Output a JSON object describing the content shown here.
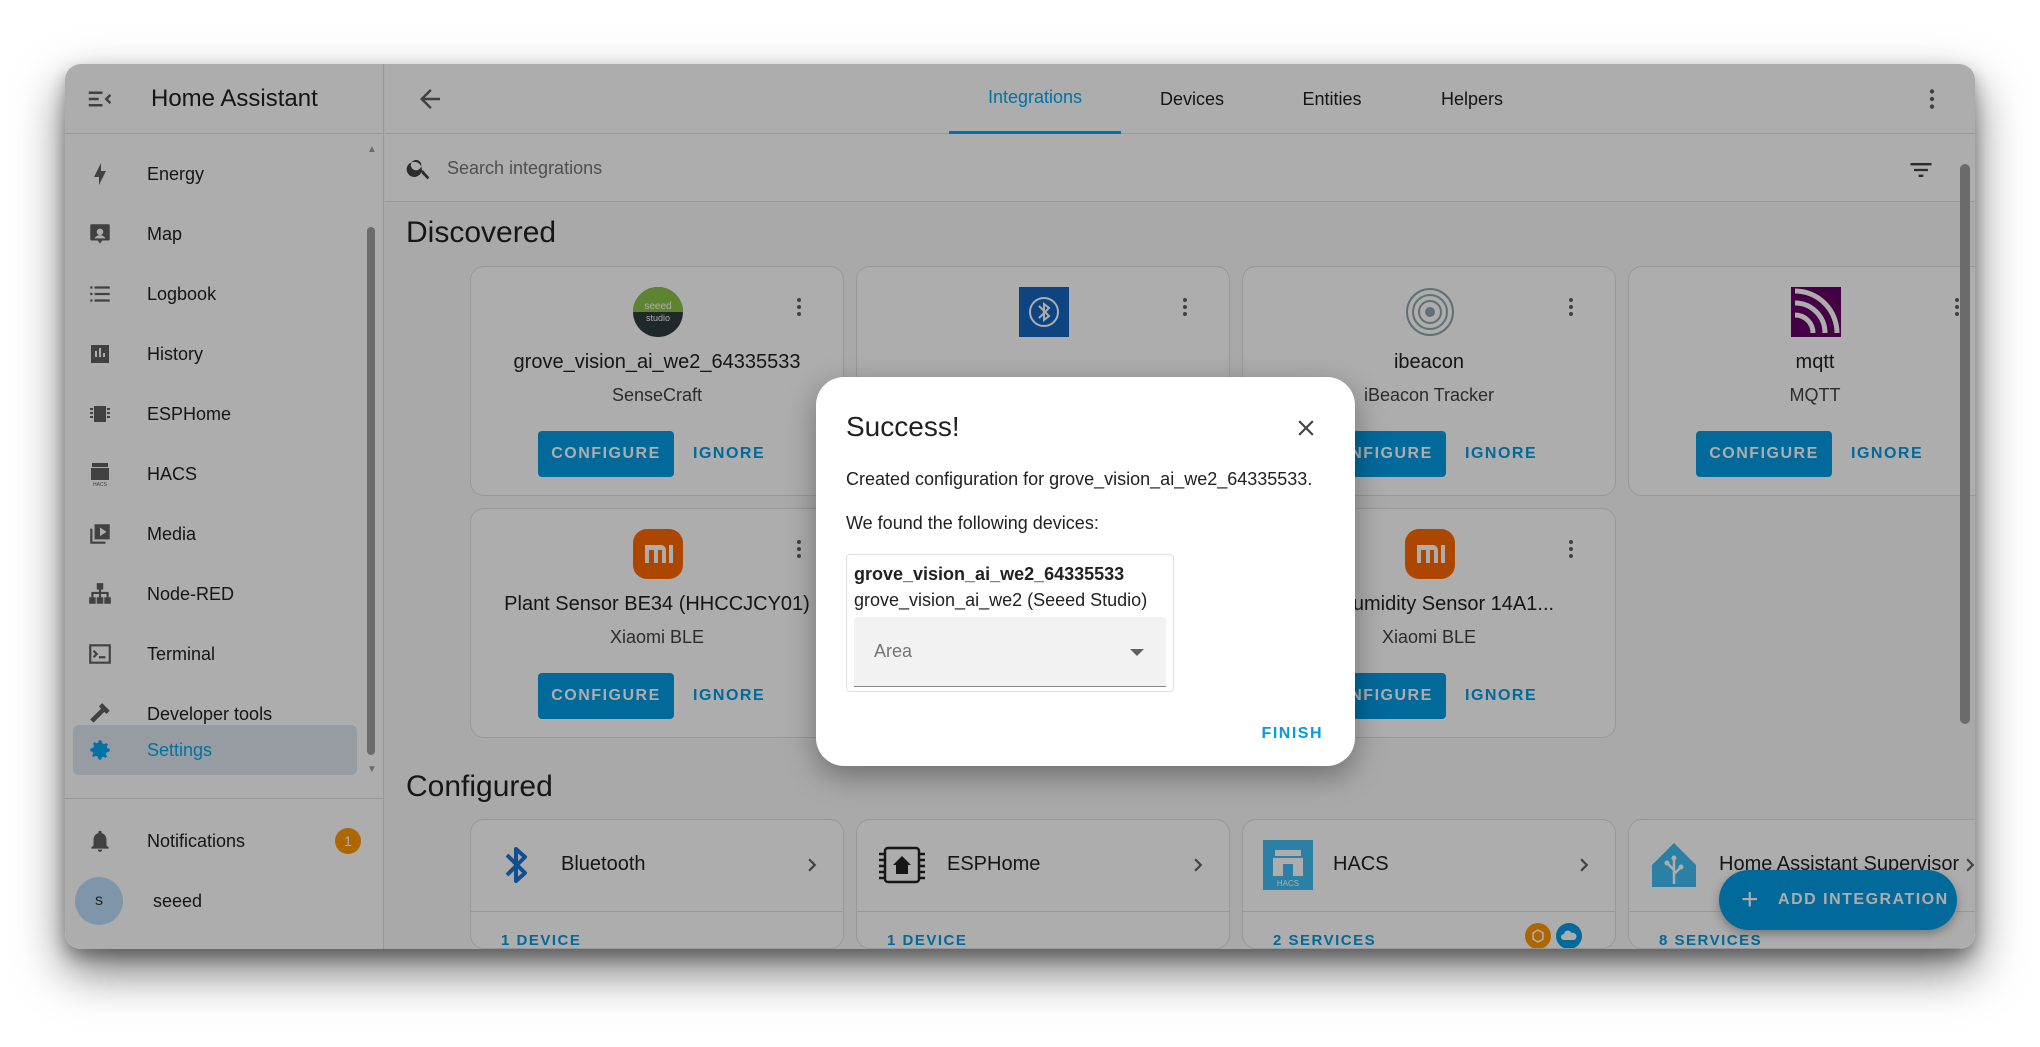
{
  "app": {
    "title": "Home Assistant"
  },
  "sidebar": {
    "items": [
      {
        "label": "Energy",
        "icon": "lightning-icon"
      },
      {
        "label": "Map",
        "icon": "map-icon"
      },
      {
        "label": "Logbook",
        "icon": "logbook-icon"
      },
      {
        "label": "History",
        "icon": "history-icon"
      },
      {
        "label": "ESPHome",
        "icon": "chip-icon"
      },
      {
        "label": "HACS",
        "icon": "hacs-icon"
      },
      {
        "label": "Media",
        "icon": "media-icon"
      },
      {
        "label": "Node-RED",
        "icon": "sitemap-icon"
      },
      {
        "label": "Terminal",
        "icon": "terminal-icon"
      },
      {
        "label": "Developer tools",
        "icon": "hammer-icon"
      },
      {
        "label": "Settings",
        "icon": "gear-icon",
        "active": true
      }
    ],
    "notifications": {
      "label": "Notifications",
      "count": "1"
    },
    "user": {
      "initial": "s",
      "name": "seeed"
    }
  },
  "tabs": [
    "Integrations",
    "Devices",
    "Entities",
    "Helpers"
  ],
  "search": {
    "placeholder": "Search integrations"
  },
  "discovered": {
    "title": "Discovered",
    "cards": [
      {
        "name": "grove_vision_ai_we2_64335533",
        "sub": "SenseCraft",
        "configure": "CONFIGURE",
        "ignore": "IGNORE"
      },
      {
        "name": "",
        "sub": "",
        "configure": "",
        "ignore": ""
      },
      {
        "name": "ibeacon",
        "sub": "iBeacon Tracker",
        "configure": "CONFIGURE",
        "ignore": "IGNORE"
      },
      {
        "name": "mqtt",
        "sub": "MQTT",
        "configure": "CONFIGURE",
        "ignore": "IGNORE"
      },
      {
        "name": "Plant Sensor BE34 (HHCCJCY01)",
        "sub": "Xiaomi BLE",
        "configure": "CONFIGURE",
        "ignore": "IGNORE"
      },
      {
        "name": "",
        "sub": "",
        "configure": "",
        "ignore": ""
      },
      {
        "name": "ure/Humidity Sensor 14A1...",
        "sub": "Xiaomi BLE",
        "configure": "CONFIGURE",
        "ignore": "IGNORE"
      }
    ]
  },
  "configured": {
    "title": "Configured",
    "cards": [
      {
        "name": "Bluetooth",
        "footer": "1 DEVICE"
      },
      {
        "name": "ESPHome",
        "footer": "1 DEVICE"
      },
      {
        "name": "HACS",
        "footer": "2 SERVICES"
      },
      {
        "name": "Home Assistant Supervisor",
        "footer": "8 SERVICES"
      }
    ]
  },
  "fab": {
    "label": "ADD INTEGRATION"
  },
  "dialog": {
    "title": "Success!",
    "text1": "Created configuration for grove_vision_ai_we2_64335533.",
    "text2": "We found the following devices:",
    "device_name": "grove_vision_ai_we2_64335533",
    "device_model": "grove_vision_ai_we2 (Seeed Studio)",
    "area_label": "Area",
    "finish": "FINISH"
  },
  "colors": {
    "accent": "#03a9f4",
    "button": "#039be5",
    "badge": "#ff9800",
    "xiaomi": "#ff6900",
    "seeed_green": "#8bc34a"
  }
}
